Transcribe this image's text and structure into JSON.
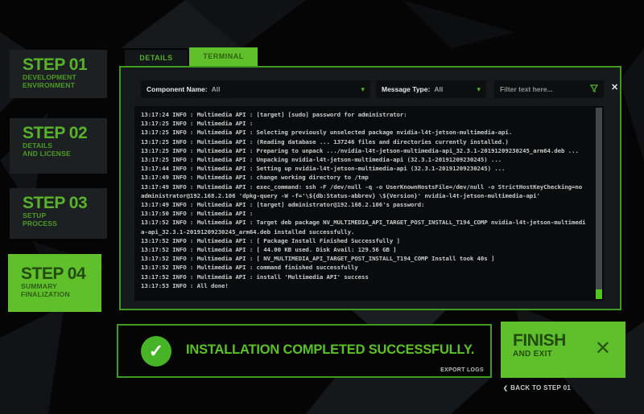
{
  "sidebar": {
    "steps": [
      {
        "title": "STEP 01",
        "subtitle": [
          "DEVELOPMENT",
          "ENVIRONMENT"
        ],
        "active": false
      },
      {
        "title": "STEP 02",
        "subtitle": [
          "DETAILS",
          "AND LICENSE"
        ],
        "active": false
      },
      {
        "title": "STEP 03",
        "subtitle": [
          "SETUP",
          "PROCESS"
        ],
        "active": false
      },
      {
        "title": "STEP 04",
        "subtitle": [
          "SUMMARY",
          "FINALIZATION"
        ],
        "active": true
      }
    ]
  },
  "tabs": [
    {
      "label": "DETAILS",
      "active": false
    },
    {
      "label": "TERMINAL",
      "active": true
    }
  ],
  "filter_bar": {
    "component_name": {
      "label": "Component Name:",
      "value": "All"
    },
    "message_type": {
      "label": "Message Type:",
      "value": "All"
    },
    "filter_input": {
      "placeholder": "Filter text here..."
    },
    "icons": {
      "chevron": "▾",
      "funnel": "filter-funnel",
      "close": "✕"
    }
  },
  "terminal": {
    "lines": [
      "13:17:24 INFO : Multimedia API : [target] [sudo] password for administrator:",
      "13:17:25 INFO : Multimedia API :",
      "13:17:25 INFO : Multimedia API : Selecting previously unselected package nvidia-l4t-jetson-multimedia-api.",
      "13:17:25 INFO : Multimedia API : (Reading database ... 137246 files and directories currently installed.)",
      "13:17:25 INFO : Multimedia API : Preparing to unpack .../nvidia-l4t-jetson-multimedia-api_32.3.1-20191209230245_arm64.deb ...",
      "13:17:25 INFO : Multimedia API : Unpacking nvidia-l4t-jetson-multimedia-api (32.3.1-20191209230245) ...",
      "13:17:44 INFO : Multimedia API : Setting up nvidia-l4t-jetson-multimedia-api (32.3.1-20191209230245) ...",
      "13:17:49 INFO : Multimedia API : change working directory to /tmp",
      "13:17:49 INFO : Multimedia API : exec_command: ssh -F /dev/null -q -o UserKnownHostsFile=/dev/null -o StrictHostKeyChecking=no",
      "administrator@192.168.2.106 'dpkg-query -W -f='\\${db:Status-abbrev} \\${Version}' nvidia-l4t-jetson-multimedia-api'",
      "13:17:49 INFO : Multimedia API : [target] administrator@192.168.2.106's password:",
      "13:17:50 INFO : Multimedia API :",
      "13:17:52 INFO : Multimedia API : Target deb package NV_MULTIMEDIA_API_TARGET_POST_INSTALL_T194_COMP nvidia-l4t-jetson-multimedi",
      "a-api_32.3.1-20191209230245_arm64.deb installed successfully.",
      "13:17:52 INFO : Multimedia API : [ Package Install Finished Successfully ]",
      "13:17:52 INFO : Multimedia API : [ 44.00 KB used. Disk Avail: 129.56 GB ]",
      "13:17:52 INFO : Multimedia API : [ NV_MULTIMEDIA_API_TARGET_POST_INSTALL_T194_COMP Install took 40s ]",
      "13:17:52 INFO : Multimedia API : command finished successfully",
      "13:17:52 INFO : Multimedia API : install 'Multimedia API' success",
      "13:17:53 INFO : All done!"
    ]
  },
  "status_bar": {
    "message": "INSTALLATION COMPLETED SUCCESSFULLY.",
    "check_glyph": "✓",
    "export_logs": "EXPORT LOGS"
  },
  "finish_button": {
    "line1": "FINISH",
    "line2": "AND EXIT",
    "close_glyph": "✕"
  },
  "back_link": {
    "chevron": "❮",
    "label": "BACK TO STEP 01"
  },
  "colors": {
    "nvidia_green": "#5fc02c",
    "green_text": "#59b32a",
    "border_green": "#3e9b1d",
    "terminal_text": "#c7cbc8"
  }
}
